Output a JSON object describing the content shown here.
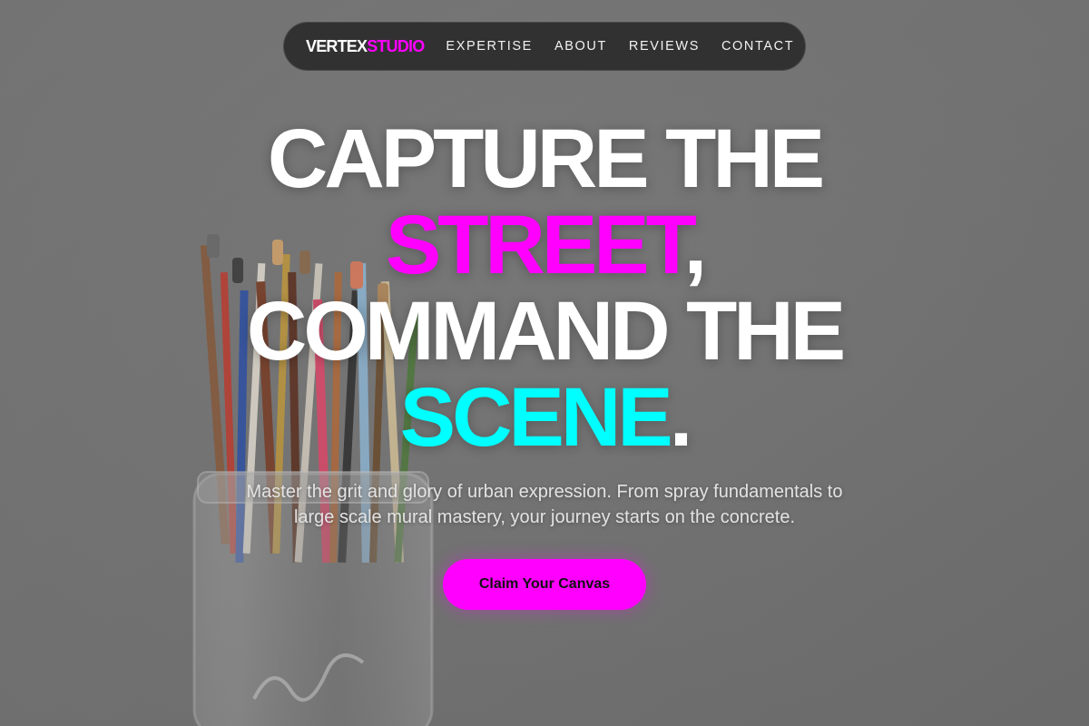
{
  "brand": {
    "name_primary": "VERTEX",
    "name_accent": "STUDIO",
    "accent_color": "#ff00ff"
  },
  "nav": {
    "items": [
      {
        "label": "EXPERTISE"
      },
      {
        "label": "ABOUT"
      },
      {
        "label": "REVIEWS"
      },
      {
        "label": "CONTACT"
      }
    ]
  },
  "hero": {
    "line1": "CAPTURE THE",
    "line2_highlight": "STREET",
    "line2_suffix": ",",
    "line3": "COMMAND THE",
    "line4_highlight": "SCENE",
    "line4_suffix": ".",
    "highlight_colors": {
      "street": "#ff00ff",
      "scene": "#00ffff"
    },
    "subtext": "Master the grit and glory of urban expression. From spray fundamentals to large scale mural mastery, your journey starts on the concrete.",
    "cta_label": "Claim Your Canvas"
  },
  "background": {
    "image_subject": "paintbrushes-in-mason-jar"
  }
}
